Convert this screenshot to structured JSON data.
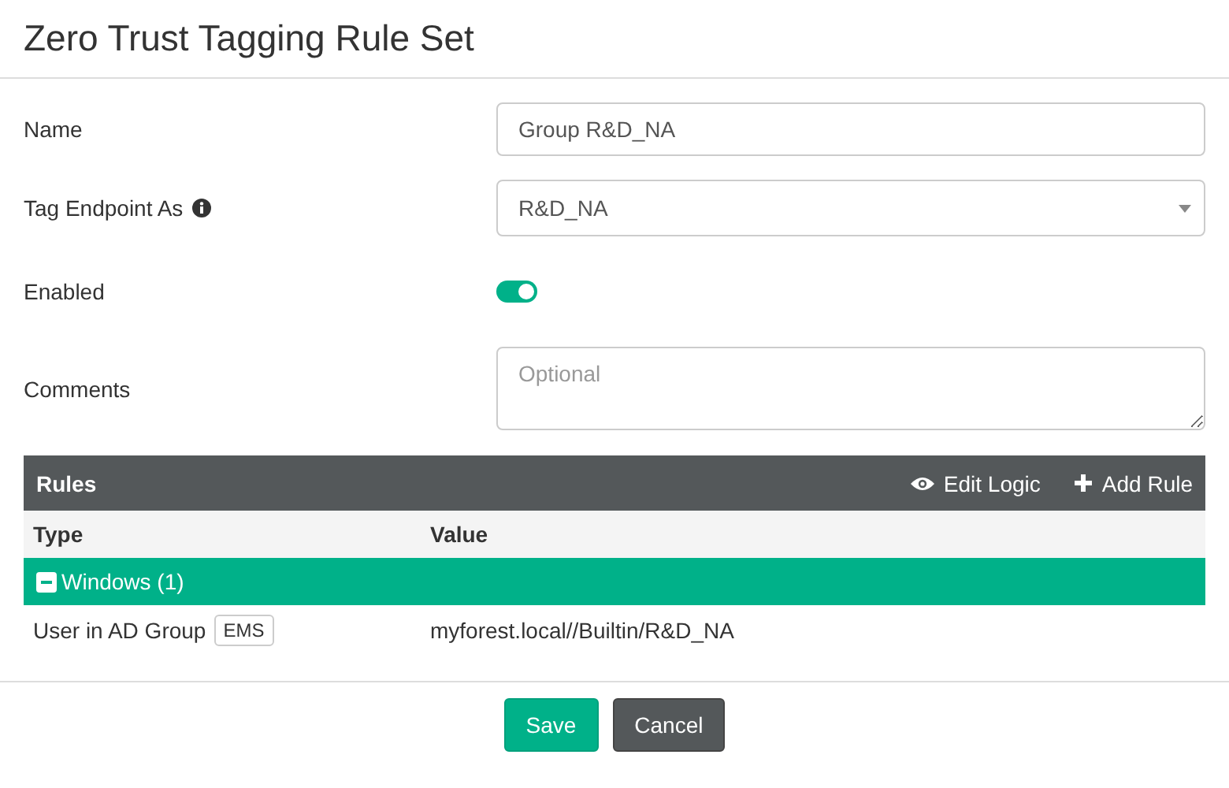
{
  "title": "Zero Trust Tagging Rule Set",
  "fields": [
    {
      "kind": "text",
      "label": "Name",
      "value": "Group R&D_NA"
    },
    {
      "kind": "select",
      "label": "Tag Endpoint As",
      "info": true,
      "value": "R&D_NA"
    },
    {
      "kind": "toggle",
      "label": "Enabled",
      "on": true
    },
    {
      "kind": "textarea",
      "label": "Comments",
      "placeholder": "Optional"
    }
  ],
  "rules": {
    "title": "Rules",
    "actions": [
      {
        "kind": "eye",
        "label": "Edit Logic"
      },
      {
        "kind": "plus",
        "label": "Add Rule"
      }
    ],
    "columns": [
      "Type",
      "Value"
    ],
    "groups": [
      {
        "label": "Windows (1)",
        "expanded": true,
        "rows": [
          {
            "type": "User in AD Group",
            "badge": "EMS",
            "value": "myforest.local//Builtin/R&D_NA"
          }
        ]
      }
    ]
  },
  "buttons": [
    {
      "kind": "primary",
      "label": "Save"
    },
    {
      "kind": "secondary",
      "label": "Cancel"
    }
  ]
}
